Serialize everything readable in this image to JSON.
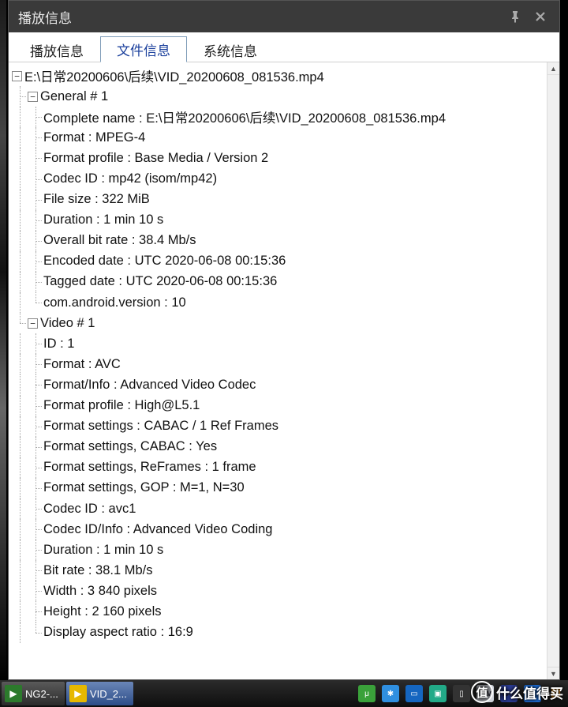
{
  "window": {
    "title": "播放信息"
  },
  "tabs": [
    {
      "label": "播放信息",
      "active": false
    },
    {
      "label": "文件信息",
      "active": true
    },
    {
      "label": "系统信息",
      "active": false
    }
  ],
  "tree": {
    "root": "E:\\日常20200606\\后续\\VID_20200608_081536.mp4",
    "sections": [
      {
        "title": "General # 1",
        "items": [
          "Complete name : E:\\日常20200606\\后续\\VID_20200608_081536.mp4",
          "Format : MPEG-4",
          "Format profile : Base Media / Version 2",
          "Codec ID : mp42 (isom/mp42)",
          "File size : 322 MiB",
          "Duration : 1 min 10 s",
          "Overall bit rate : 38.4 Mb/s",
          "Encoded date : UTC 2020-06-08 00:15:36",
          "Tagged date : UTC 2020-06-08 00:15:36",
          "com.android.version : 10"
        ]
      },
      {
        "title": "Video # 1",
        "items": [
          "ID : 1",
          "Format : AVC",
          "Format/Info : Advanced Video Codec",
          "Format profile : High@L5.1",
          "Format settings : CABAC / 1 Ref Frames",
          "Format settings, CABAC : Yes",
          "Format settings, ReFrames : 1 frame",
          "Format settings, GOP : M=1, N=30",
          "Codec ID : avc1",
          "Codec ID/Info : Advanced Video Coding",
          "Duration : 1 min 10 s",
          "Bit rate : 38.1 Mb/s",
          "Width : 3 840 pixels",
          "Height : 2 160 pixels",
          "Display aspect ratio : 16:9"
        ]
      }
    ]
  },
  "taskbar": {
    "tasks": [
      {
        "label": "NG2-...",
        "color": "#2c7a2c"
      },
      {
        "label": "VID_2...",
        "color": "#e6b800"
      }
    ],
    "tray": [
      {
        "name": "utorrent-icon",
        "bg": "#3aa13a",
        "txt": "μ"
      },
      {
        "name": "star-icon",
        "bg": "#2f8fe0",
        "txt": "✱"
      },
      {
        "name": "screenshot-icon",
        "bg": "#1566c0",
        "txt": "▭"
      },
      {
        "name": "folder-icon",
        "bg": "#2a8",
        "txt": "▣"
      },
      {
        "name": "phone-icon",
        "bg": "#333",
        "txt": "▯"
      },
      {
        "name": "lav-splitter-icon",
        "bg": "#cfd3da",
        "txt": "LAV"
      },
      {
        "name": "lav-video-icon",
        "bg": "#2a3a8f",
        "txt": "LAV"
      },
      {
        "name": "bluetooth-icon",
        "bg": "#1e6fd9",
        "txt": "✲"
      },
      {
        "name": "wifi-icon",
        "bg": "transparent",
        "txt": "📶"
      }
    ]
  },
  "watermark": "什么值得买"
}
